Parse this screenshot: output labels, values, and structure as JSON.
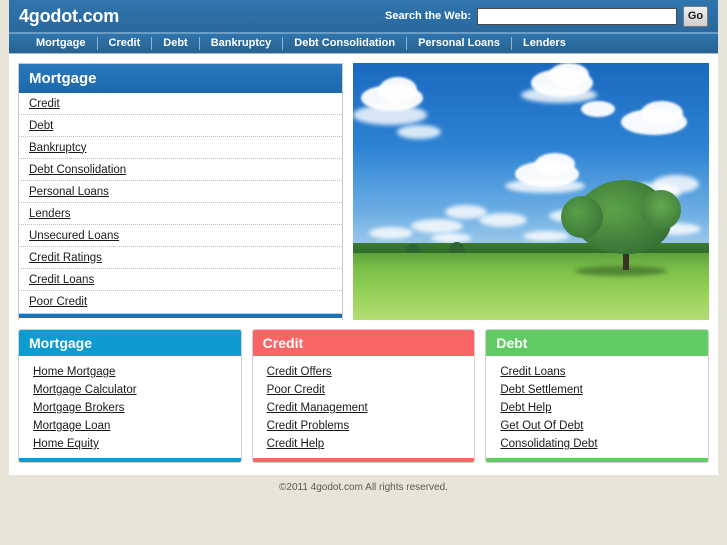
{
  "site": {
    "logo": "4godot.com",
    "background_color": "#e8e5d8",
    "header_color": "#2b6ca3"
  },
  "header": {
    "search_label": "Search the Web:",
    "search_value": "",
    "search_placeholder": "",
    "go_label": "Go"
  },
  "nav": {
    "items": [
      {
        "label": "Mortgage"
      },
      {
        "label": "Credit"
      },
      {
        "label": "Debt"
      },
      {
        "label": "Bankruptcy"
      },
      {
        "label": "Debt Consolidation"
      },
      {
        "label": "Personal Loans"
      },
      {
        "label": "Lenders"
      }
    ]
  },
  "sidebar": {
    "title": "Mortgage",
    "accent_color": "#2171b5",
    "items": [
      {
        "label": "Credit"
      },
      {
        "label": "Debt"
      },
      {
        "label": "Bankruptcy"
      },
      {
        "label": "Debt Consolidation"
      },
      {
        "label": "Personal Loans"
      },
      {
        "label": "Lenders"
      },
      {
        "label": "Unsecured Loans"
      },
      {
        "label": "Credit Ratings"
      },
      {
        "label": "Credit Loans"
      },
      {
        "label": "Poor Credit"
      }
    ]
  },
  "hero": {
    "alt": "Green meadow field with a large tree under a blue sky with white clouds"
  },
  "boxes": [
    {
      "title": "Mortgage",
      "color": "#0e9bd0",
      "items": [
        {
          "label": "Home Mortgage"
        },
        {
          "label": "Mortgage Calculator"
        },
        {
          "label": "Mortgage Brokers"
        },
        {
          "label": "Mortgage Loan"
        },
        {
          "label": "Home Equity"
        }
      ]
    },
    {
      "title": "Credit",
      "color": "#f96565",
      "items": [
        {
          "label": "Credit Offers"
        },
        {
          "label": "Poor Credit"
        },
        {
          "label": "Credit Management"
        },
        {
          "label": "Credit Problems"
        },
        {
          "label": "Credit Help"
        }
      ]
    },
    {
      "title": "Debt",
      "color": "#5fcb62",
      "items": [
        {
          "label": "Credit Loans"
        },
        {
          "label": "Debt Settlement"
        },
        {
          "label": "Debt Help"
        },
        {
          "label": "Get Out Of Debt"
        },
        {
          "label": "Consolidating Debt"
        }
      ]
    }
  ],
  "footer": {
    "copyright": "©2011 4godot.com All rights reserved."
  }
}
